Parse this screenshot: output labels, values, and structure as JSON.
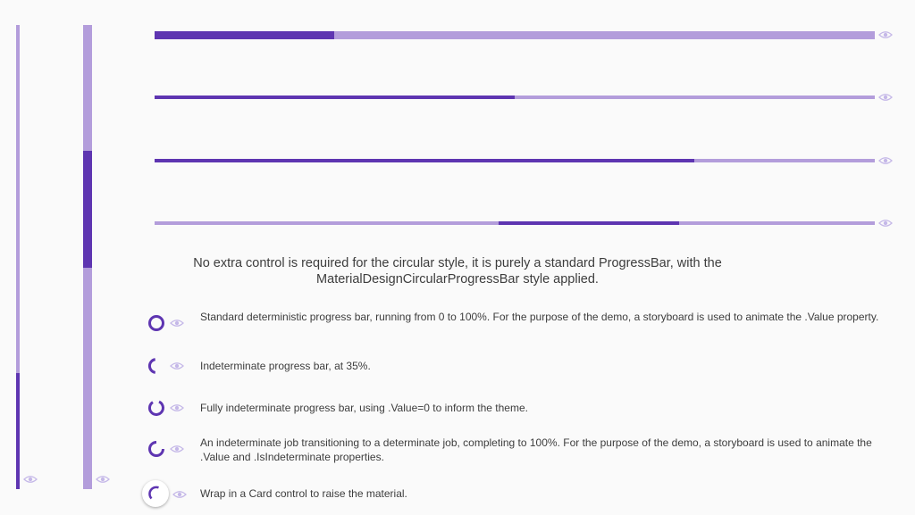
{
  "colors": {
    "accent": "#5e35b1",
    "track": "#b39ddb",
    "eye": "#c5b8e8",
    "background": "#fafafa"
  },
  "vertical_bars": [
    {
      "name": "vertical-progress-thin",
      "value": 0.25
    },
    {
      "name": "vertical-progress-wide",
      "value": 0.5,
      "indeterminate_segment": true
    }
  ],
  "horizontal_bars": [
    {
      "name": "horizontal-progress-thick",
      "value": 0.25
    },
    {
      "name": "horizontal-progress-50",
      "value": 0.5
    },
    {
      "name": "horizontal-progress-75",
      "value": 0.75
    },
    {
      "name": "horizontal-progress-indeterminate",
      "value": 0.25,
      "indeterminate_segment": true
    }
  ],
  "caption": {
    "line1": "No extra control is required for the circular style, it is purely a standard ProgressBar, with the",
    "line2": "MaterialDesignCircularProgressBar style applied."
  },
  "icons": {
    "view_source": "eye-icon"
  },
  "circular_items": [
    {
      "name": "circular-standard",
      "text": "Standard deterministic progress bar, running from 0 to 100%.  For the purpose of the demo, a storyboard is used to animate the .Value property.",
      "value": 1.0
    },
    {
      "name": "circular-35",
      "text": "Indeterminate progress bar, at 35%.",
      "value": 0.35
    },
    {
      "name": "circular-full-indeterminate",
      "text": "Fully indeterminate progress bar, using .Value=0 to inform the theme.",
      "value": 0.85
    },
    {
      "name": "circular-transition",
      "text": "An indeterminate job transitioning to a determinate job, completing to 100%.  For the purpose of the demo, a storyboard is used to animate the .Value and .IsIndeterminate properties.",
      "value": 0.75
    },
    {
      "name": "circular-card",
      "text": "Wrap in a Card control to raise the material.",
      "value": 0.4
    }
  ]
}
